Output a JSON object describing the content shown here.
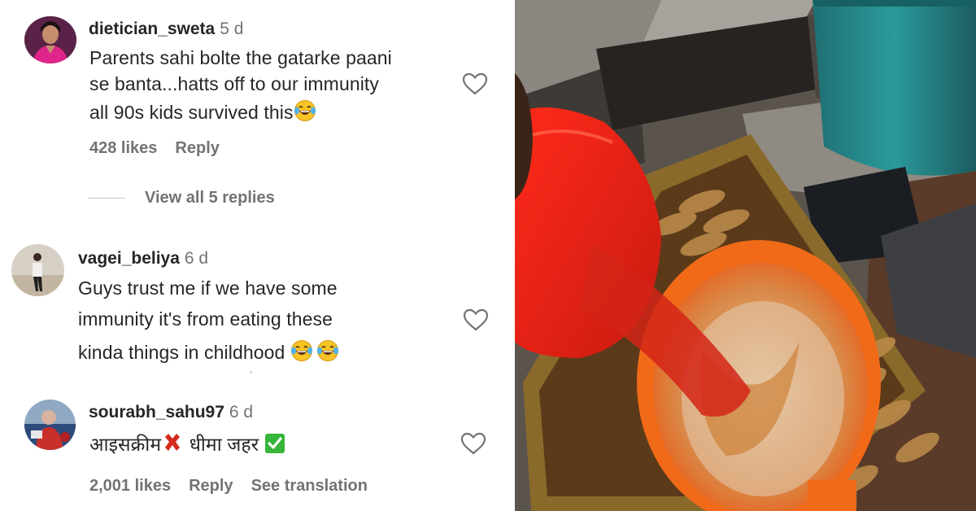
{
  "comments": [
    {
      "username": "dietician_sweta",
      "age": "5 d",
      "lines": [
        "Parents sahi bolte the gatarke paani",
        "se banta...hatts off to our immunity",
        "all 90s kids survived this"
      ],
      "likes": "428 likes",
      "reply": "Reply",
      "view_replies": "View all 5 replies"
    },
    {
      "username": "vagei_beliya",
      "age": "6 d",
      "lines": [
        "Guys trust me if we have some",
        "immunity it's from eating these",
        "kinda things in childhood"
      ]
    },
    {
      "username": "sourabh_sahu97",
      "age": "6 d",
      "text_a": "आइसक्रीम",
      "text_b": "धीमा जहर",
      "likes": "2,001 likes",
      "reply": "Reply",
      "translation": "See translation"
    }
  ],
  "colors": {
    "text": "#262626",
    "secondary": "#737373",
    "emoji_face": "#f7c325"
  },
  "icons": [
    "heart-outline-icon",
    "laughing-tears-emoji",
    "cross-mark-emoji",
    "check-mark-emoji"
  ]
}
